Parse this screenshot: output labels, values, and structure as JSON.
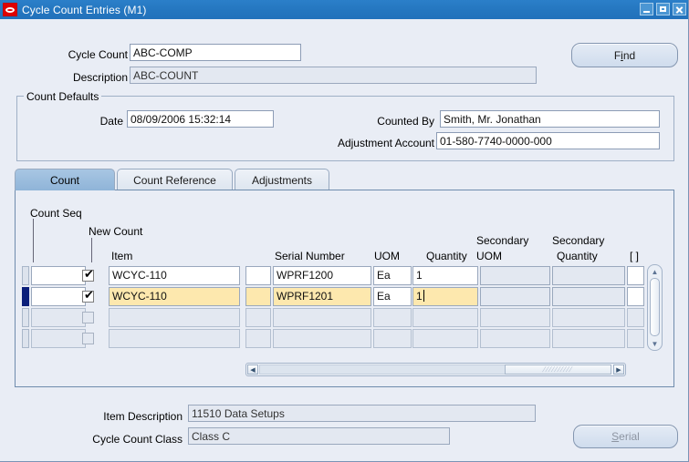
{
  "window": {
    "title": "Cycle Count Entries (M1)",
    "icon": "oracle-logo-icon",
    "minimize": "_",
    "maximize": "□",
    "close": "×"
  },
  "header": {
    "cycle_count_label": "Cycle Count",
    "cycle_count_value": "ABC-COMP",
    "description_label": "Description",
    "description_value": "ABC-COUNT",
    "find_button": "Find"
  },
  "count_defaults": {
    "group_title": "Count Defaults",
    "date_label": "Date",
    "date_value": "08/09/2006 15:32:14",
    "counted_by_label": "Counted By",
    "counted_by_value": "Smith, Mr. Jonathan",
    "adjustment_account_label": "Adjustment Account",
    "adjustment_account_value": "01-580-7740-0000-000"
  },
  "tabs": [
    {
      "label": "Count",
      "active": true
    },
    {
      "label": "Count Reference",
      "active": false
    },
    {
      "label": "Adjustments",
      "active": false
    }
  ],
  "grid": {
    "headers": {
      "count_seq": "Count Seq",
      "new_count": "New Count",
      "item": "Item",
      "serial_number": "Serial Number",
      "uom": "UOM",
      "quantity": "Quantity",
      "secondary_uom_line1": "Secondary",
      "secondary_uom_line2": "UOM",
      "secondary_quantity_line1": "Secondary",
      "secondary_quantity_line2": "Quantity",
      "flex": "[  ]"
    },
    "rows": [
      {
        "count_seq": "",
        "new_count_checked": true,
        "item": "WCYC-110",
        "serial_prefix": "",
        "serial_number": "WPRF1200",
        "uom": "Ea",
        "quantity": "1",
        "secondary_uom": "",
        "secondary_quantity": "",
        "flex": "",
        "state": "normal",
        "current": false
      },
      {
        "count_seq": "",
        "new_count_checked": true,
        "item": "WCYC-110",
        "serial_prefix": "",
        "serial_number": "WPRF1201",
        "uom": "Ea",
        "quantity": "1",
        "secondary_uom": "",
        "secondary_quantity": "",
        "flex": "",
        "state": "selected",
        "current": true
      },
      {
        "count_seq": "",
        "new_count_checked": false,
        "item": "",
        "serial_prefix": "",
        "serial_number": "",
        "uom": "",
        "quantity": "",
        "secondary_uom": "",
        "secondary_quantity": "",
        "flex": "",
        "state": "disabled",
        "current": false
      },
      {
        "count_seq": "",
        "new_count_checked": false,
        "item": "",
        "serial_prefix": "",
        "serial_number": "",
        "uom": "",
        "quantity": "",
        "secondary_uom": "",
        "secondary_quantity": "",
        "flex": "",
        "state": "disabled",
        "current": false
      }
    ],
    "scroll_left_arrow": "◀",
    "scroll_right_arrow": "▶",
    "scroll_up_arrow": "▲",
    "scroll_down_arrow": "▼"
  },
  "footer": {
    "item_description_label": "Item Description",
    "item_description_value": "11510 Data Setups",
    "cycle_count_class_label": "Cycle Count Class",
    "cycle_count_class_value": "Class C",
    "serial_button": "Serial",
    "serial_button_disabled": true
  },
  "colors": {
    "titlebar": "#2577c0",
    "window_bg": "#e9edf5",
    "active_tab": "#8fb4d8",
    "selected_row": "#fde8ae",
    "current_record_marker": "#0b1f7a",
    "field_border": "#8c9cb5"
  }
}
